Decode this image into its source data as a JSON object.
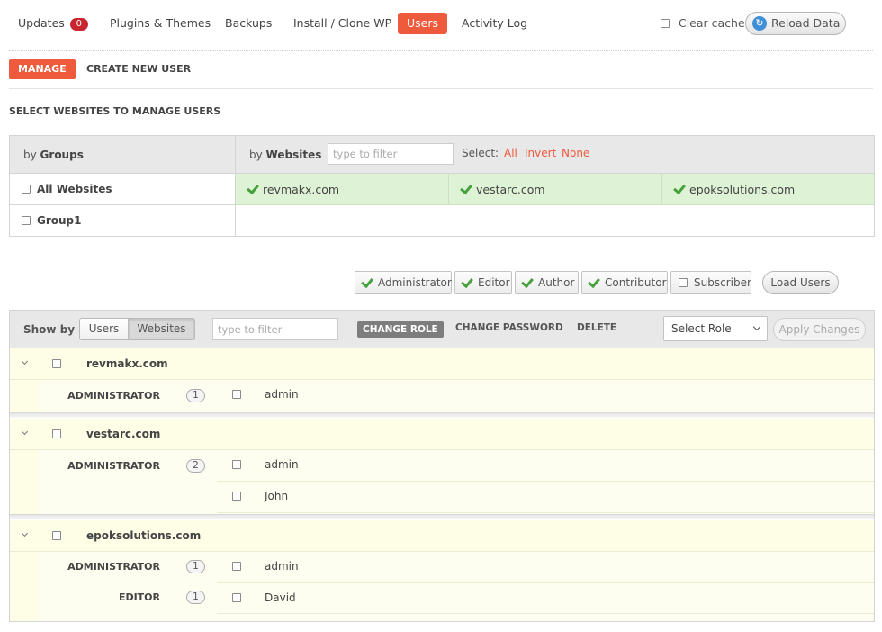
{
  "nav": {
    "updates": "Updates",
    "updates_count": "0",
    "plugins_themes": "Plugins & Themes",
    "backups": "Backups",
    "install_clone": "Install / Clone WP",
    "users": "Users",
    "activity_log": "Activity Log",
    "clear_cache": "Clear cache",
    "reload_data": "Reload Data"
  },
  "subtabs": {
    "manage": "MANAGE",
    "create_new_user": "CREATE NEW USER"
  },
  "section_title": "SELECT WEBSITES TO MANAGE USERS",
  "selector": {
    "by": "by",
    "groups": "Groups",
    "websites": "Websites",
    "filter_placeholder": "type to filter",
    "select_label": "Select:",
    "all": "All",
    "invert": "Invert",
    "none": "None",
    "groups_list": [
      "All Websites",
      "Group1"
    ],
    "sites": [
      "revmakx.com",
      "vestarc.com",
      "epoksolutions.com"
    ]
  },
  "roles": {
    "administrator": "Administrator",
    "editor": "Editor",
    "author": "Author",
    "contributor": "Contributor",
    "subscriber": "Subscriber",
    "load_users": "Load Users"
  },
  "toolbar": {
    "show_by": "Show by",
    "users": "Users",
    "websites": "Websites",
    "filter_placeholder": "type to filter",
    "change_role": "CHANGE ROLE",
    "change_password": "CHANGE PASSWORD",
    "delete": "DELETE",
    "select_role": "Select Role",
    "apply_changes": "Apply Changes"
  },
  "site_blocks": [
    {
      "site": "revmakx.com",
      "groups": [
        {
          "role": "ADMINISTRATOR",
          "count": "1",
          "users": [
            "admin"
          ]
        }
      ]
    },
    {
      "site": "vestarc.com",
      "groups": [
        {
          "role": "ADMINISTRATOR",
          "count": "2",
          "users": [
            "admin",
            "John"
          ]
        }
      ]
    },
    {
      "site": "epoksolutions.com",
      "groups": [
        {
          "role": "ADMINISTRATOR",
          "count": "1",
          "users": [
            "admin"
          ]
        },
        {
          "role": "EDITOR",
          "count": "1",
          "users": [
            "David"
          ]
        }
      ]
    }
  ]
}
